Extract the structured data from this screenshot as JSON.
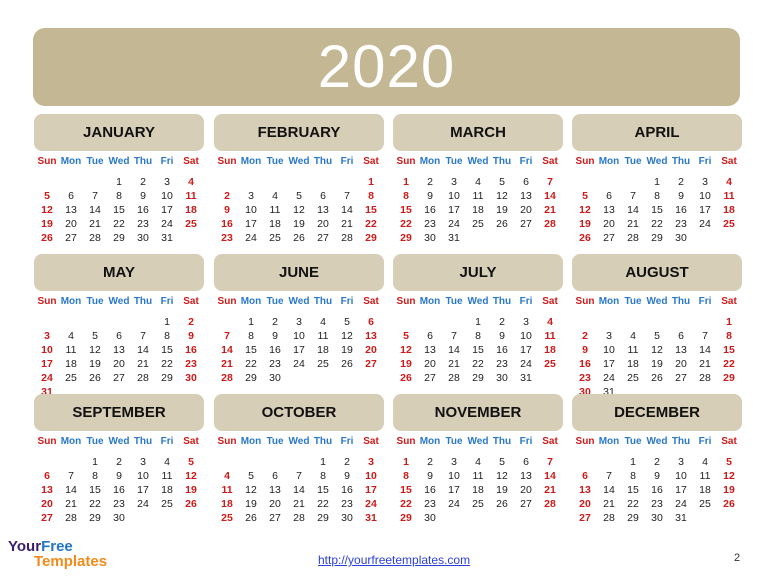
{
  "year": "2020",
  "colors": {
    "banner": "#c3b794",
    "month_header": "#d6ceb6",
    "weekday_label": "#2a78c8",
    "weekend": "#cc1a1a",
    "weekday_date": "#222222"
  },
  "weekdays": [
    "Sun",
    "Mon",
    "Tue",
    "Wed",
    "Thu",
    "Fri",
    "Sat"
  ],
  "months": [
    {
      "name": "JANUARY",
      "start": 3,
      "days": 31
    },
    {
      "name": "FEBRUARY",
      "start": 6,
      "days": 29
    },
    {
      "name": "MARCH",
      "start": 0,
      "days": 31
    },
    {
      "name": "APRIL",
      "start": 3,
      "days": 30
    },
    {
      "name": "MAY",
      "start": 5,
      "days": 31
    },
    {
      "name": "JUNE",
      "start": 1,
      "days": 30
    },
    {
      "name": "JULY",
      "start": 3,
      "days": 31
    },
    {
      "name": "AUGUST",
      "start": 6,
      "days": 31
    },
    {
      "name": "SEPTEMBER",
      "start": 2,
      "days": 30
    },
    {
      "name": "OCTOBER",
      "start": 4,
      "days": 31
    },
    {
      "name": "NOVEMBER",
      "start": 0,
      "days": 30
    },
    {
      "name": "DECEMBER",
      "start": 2,
      "days": 31
    }
  ],
  "logo": {
    "line1_a": "Your",
    "line1_b": "Free",
    "line2": "Templates"
  },
  "footer": {
    "link": "http://yourfreetemplates.com",
    "page_number": "2"
  }
}
